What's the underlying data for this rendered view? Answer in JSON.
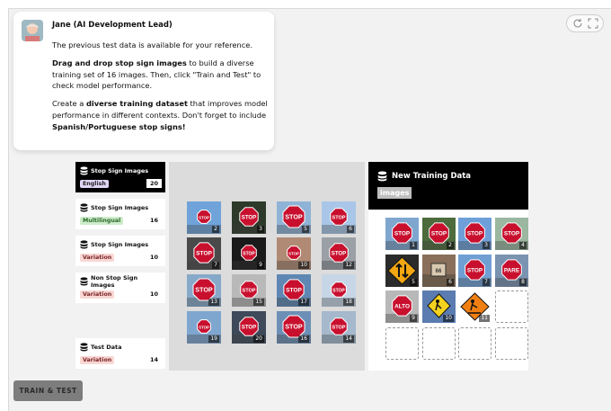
{
  "message": {
    "sender": "Jane (AI Development Lead)",
    "line1": "The previous test data is available for your reference.",
    "p2_bold": "Drag and drop stop sign images",
    "p2_rest": " to build a diverse training set of 16 images. Then, click \"Train and Test\" to check model performance.",
    "p3_a": "Create a ",
    "p3_bold": "diverse training dataset",
    "p3_b": " that improves model performance in different contexts. Don't forget to include ",
    "p3_bold2": "Spanish/Portuguese stop signs!"
  },
  "categories": [
    {
      "title": "Stop Sign Images",
      "tag": "English",
      "count": "20"
    },
    {
      "title": "Stop Sign Images",
      "tag": "Multilingual",
      "count": "16"
    },
    {
      "title": "Stop Sign Images",
      "tag": "Variation",
      "count": "10"
    },
    {
      "title": "Non Stop Sign Images",
      "tag": "Variation",
      "count": "10"
    },
    {
      "title": "Test Data",
      "tag": "Variation",
      "count": "14"
    }
  ],
  "grid_numbers": [
    "2",
    "3",
    "5",
    "6",
    "7",
    "9",
    "10",
    "12",
    "13",
    "15",
    "17",
    "18",
    "19",
    "20",
    "16",
    "14"
  ],
  "training": {
    "title": "New Training Data",
    "tag": "images",
    "numbers": [
      "1",
      "2",
      "3",
      "4",
      "5",
      "6",
      "7",
      "8",
      "9",
      "10",
      "11"
    ]
  },
  "icons": [
    "refresh-icon",
    "expand-icon",
    "database-icon"
  ],
  "button": {
    "label": "TRAIN & TEST"
  },
  "colors": {
    "accent": "#000000",
    "stop_red": "#c8102e",
    "button": "#7d7d7d"
  }
}
